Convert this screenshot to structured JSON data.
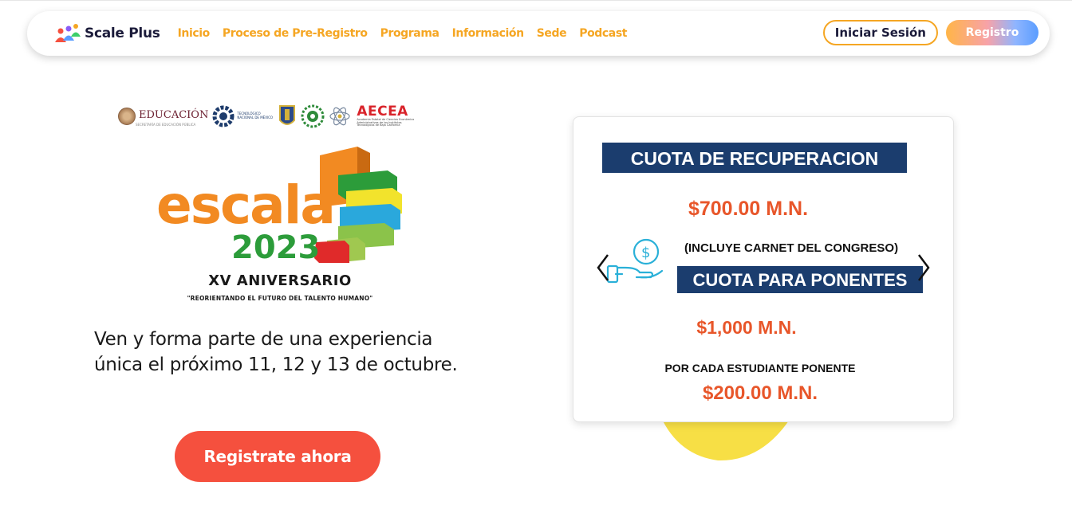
{
  "brand": {
    "name": "Scale Plus"
  },
  "nav": {
    "links": [
      "Inicio",
      "Proceso de Pre-Registro",
      "Programa",
      "Información",
      "Sede",
      "Podcast"
    ],
    "login_label": "Iniciar Sesión",
    "register_label": "Registro"
  },
  "sponsors": {
    "sep": "EDUCACIÓN",
    "sep_sub": "SECRETARÍA DE EDUCACIÓN PÚBLICA",
    "tecnm": "TECNOLÓGICO NACIONAL DE MÉXICO",
    "aecea": "AECEA",
    "aecea_sub": "Academia Estatal de Ciencias Económico Administrativas de los Institutos Tecnológicos de Baja California"
  },
  "event": {
    "logo_word": "escala",
    "year": "2023",
    "anniversary": "XV ANIVERSARIO",
    "motto": "\"REORIENTANDO EL FUTURO DEL TALENTO HUMANO\""
  },
  "hero": {
    "text": "Ven y forma parte de una experiencia única el próximo 11, 12 y 13 de octubre.",
    "cta_label": "Registrate ahora"
  },
  "slide": {
    "heading1": "CUOTA DE RECUPERACION",
    "price1": "$700.00 M.N.",
    "includes": "(INCLUYE CARNET DEL CONGRESO)",
    "heading2": "CUOTA PARA PONENTES",
    "price2": "$1,000 M.N.",
    "per_student": "POR CADA ESTUDIANTE PONENTE",
    "price3": "$200.00 M.N."
  },
  "colors": {
    "accent_orange": "#f5a623",
    "cta_red": "#f5503e",
    "navy": "#1b3d6e",
    "price_orange": "#e8562a"
  },
  "icons": [
    "people-logo-icon",
    "dollar-hand-icon",
    "chevron-left-icon",
    "chevron-right-icon"
  ]
}
